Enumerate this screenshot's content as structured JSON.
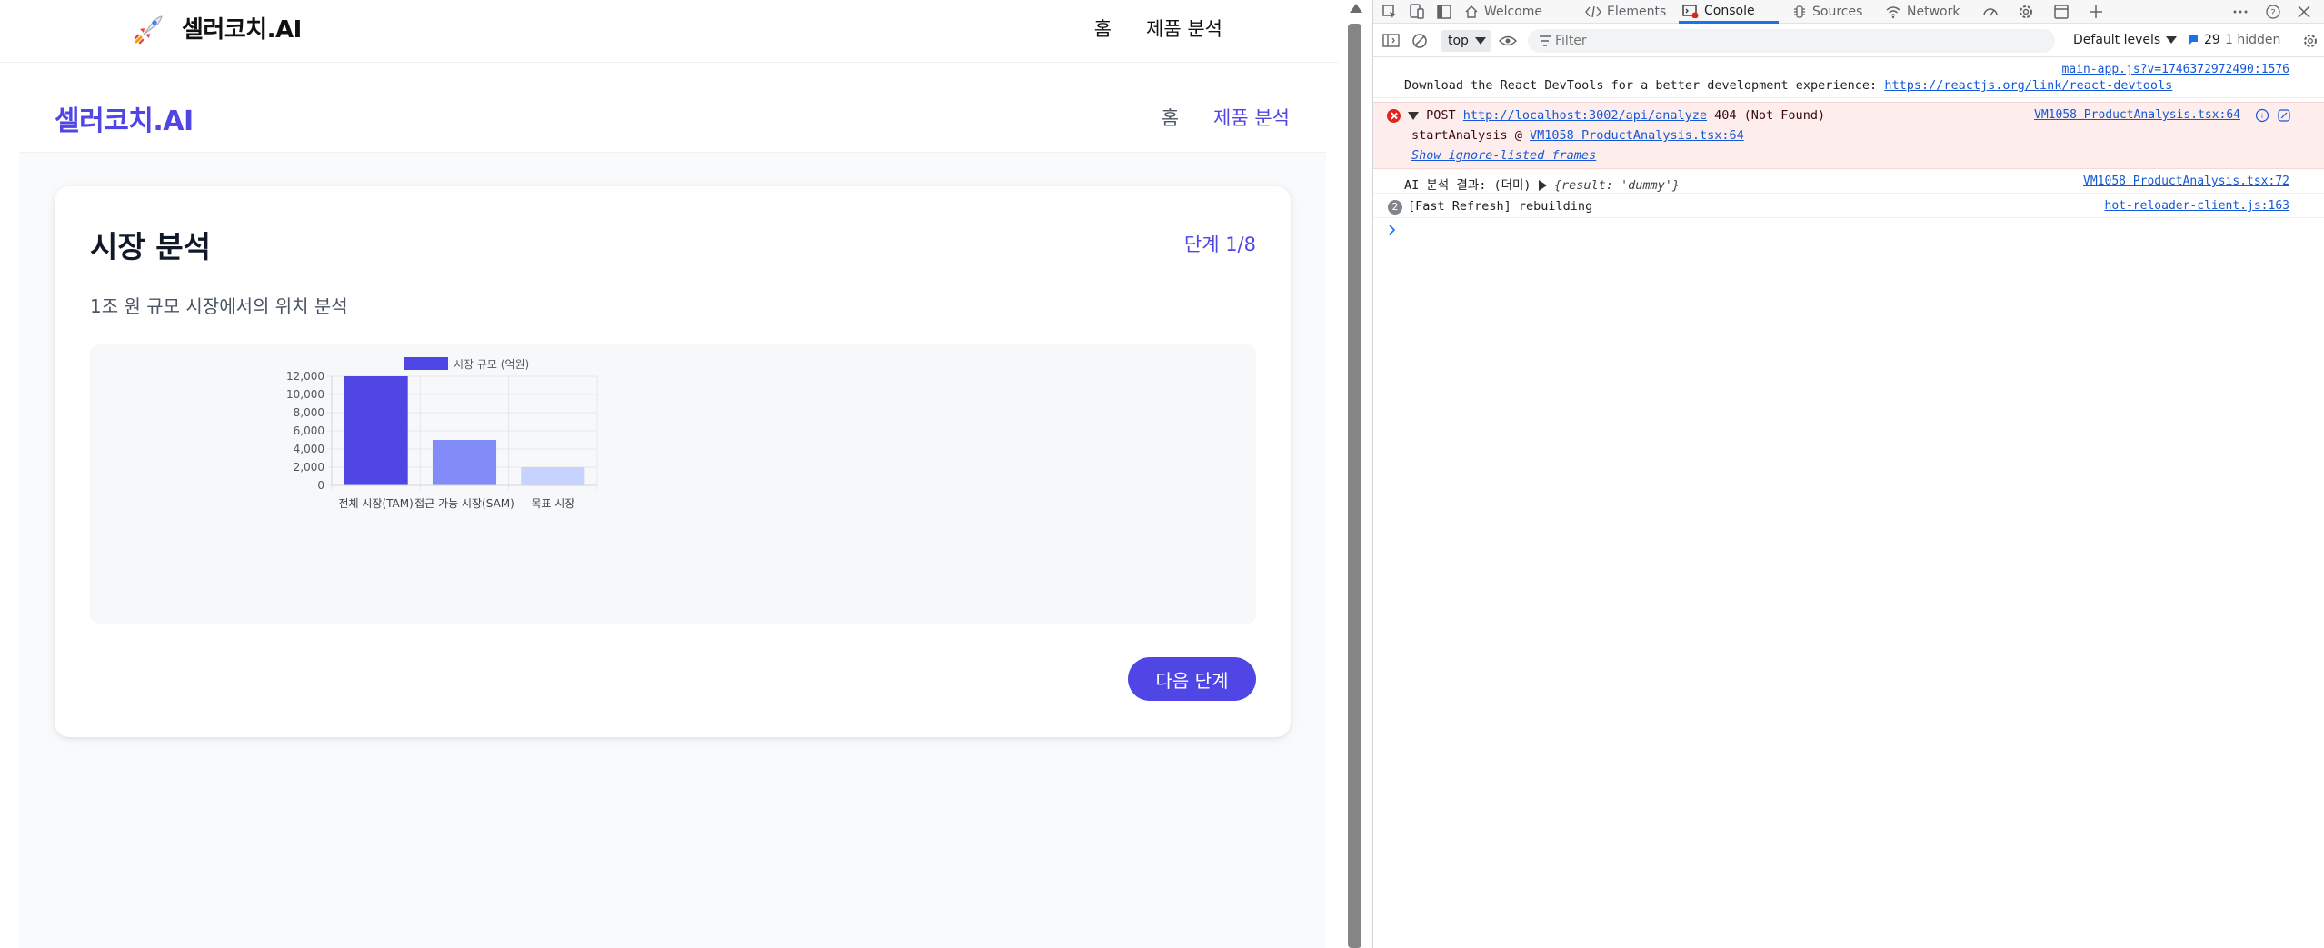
{
  "app": {
    "top_brand": "셀러코치.AI",
    "top_nav": [
      "홈",
      "제품 분석"
    ],
    "inner_brand": "셀러코치.AI",
    "inner_nav": [
      "홈",
      "제품 분석"
    ],
    "card": {
      "title": "시장 분석",
      "step": "단계 1/8",
      "description": "1조 원 규모 시장에서의 위치 분석",
      "next_button": "다음 단계"
    }
  },
  "chart_data": {
    "type": "bar",
    "categories": [
      "전체 시장(TAM)",
      "접근 가능 시장(SAM)",
      "목표 시장"
    ],
    "series": [
      {
        "name": "시장 규모 (억원)",
        "values": [
          12000,
          5000,
          2000
        ]
      }
    ],
    "bar_colors": [
      "#4f46e5",
      "#818cf8",
      "#c7d2fe"
    ],
    "ylim": [
      0,
      12000
    ],
    "yticks": [
      0,
      2000,
      4000,
      6000,
      8000,
      10000,
      12000
    ],
    "ytick_labels": [
      "0",
      "2,000",
      "4,000",
      "6,000",
      "8,000",
      "10,000",
      "12,000"
    ],
    "legend_position": "top",
    "grid": true
  },
  "devtools": {
    "tabs": [
      "Welcome",
      "Elements",
      "Console",
      "Sources",
      "Network"
    ],
    "active_tab": "Console",
    "context": "top",
    "filter_placeholder": "Filter",
    "levels": "Default levels",
    "message_count": "29",
    "hidden_count": "1 hidden",
    "messages": [
      {
        "text": "Download the React DevTools for a better development experience: ",
        "link": "https://reactjs.org/link/react-devtools",
        "source": "main-app.js?v=1746372972490:1576"
      },
      {
        "level": "error",
        "method": "POST",
        "url": "http://localhost:3002/api/analyze",
        "status": "404 (Not Found)",
        "source": "VM1058 ProductAnalysis.tsx:64",
        "stack_fn": "startAnalysis @ ",
        "stack_link": "VM1058 ProductAnalysis.tsx:64",
        "ignore_link": "Show ignore-listed frames"
      },
      {
        "text": "AI 분석 결과: (더미) ",
        "object": "{result: 'dummy'}",
        "source": "VM1058 ProductAnalysis.tsx:72"
      },
      {
        "count": "2",
        "text": "[Fast Refresh] rebuilding",
        "source": "hot-reloader-client.js:163"
      }
    ]
  }
}
